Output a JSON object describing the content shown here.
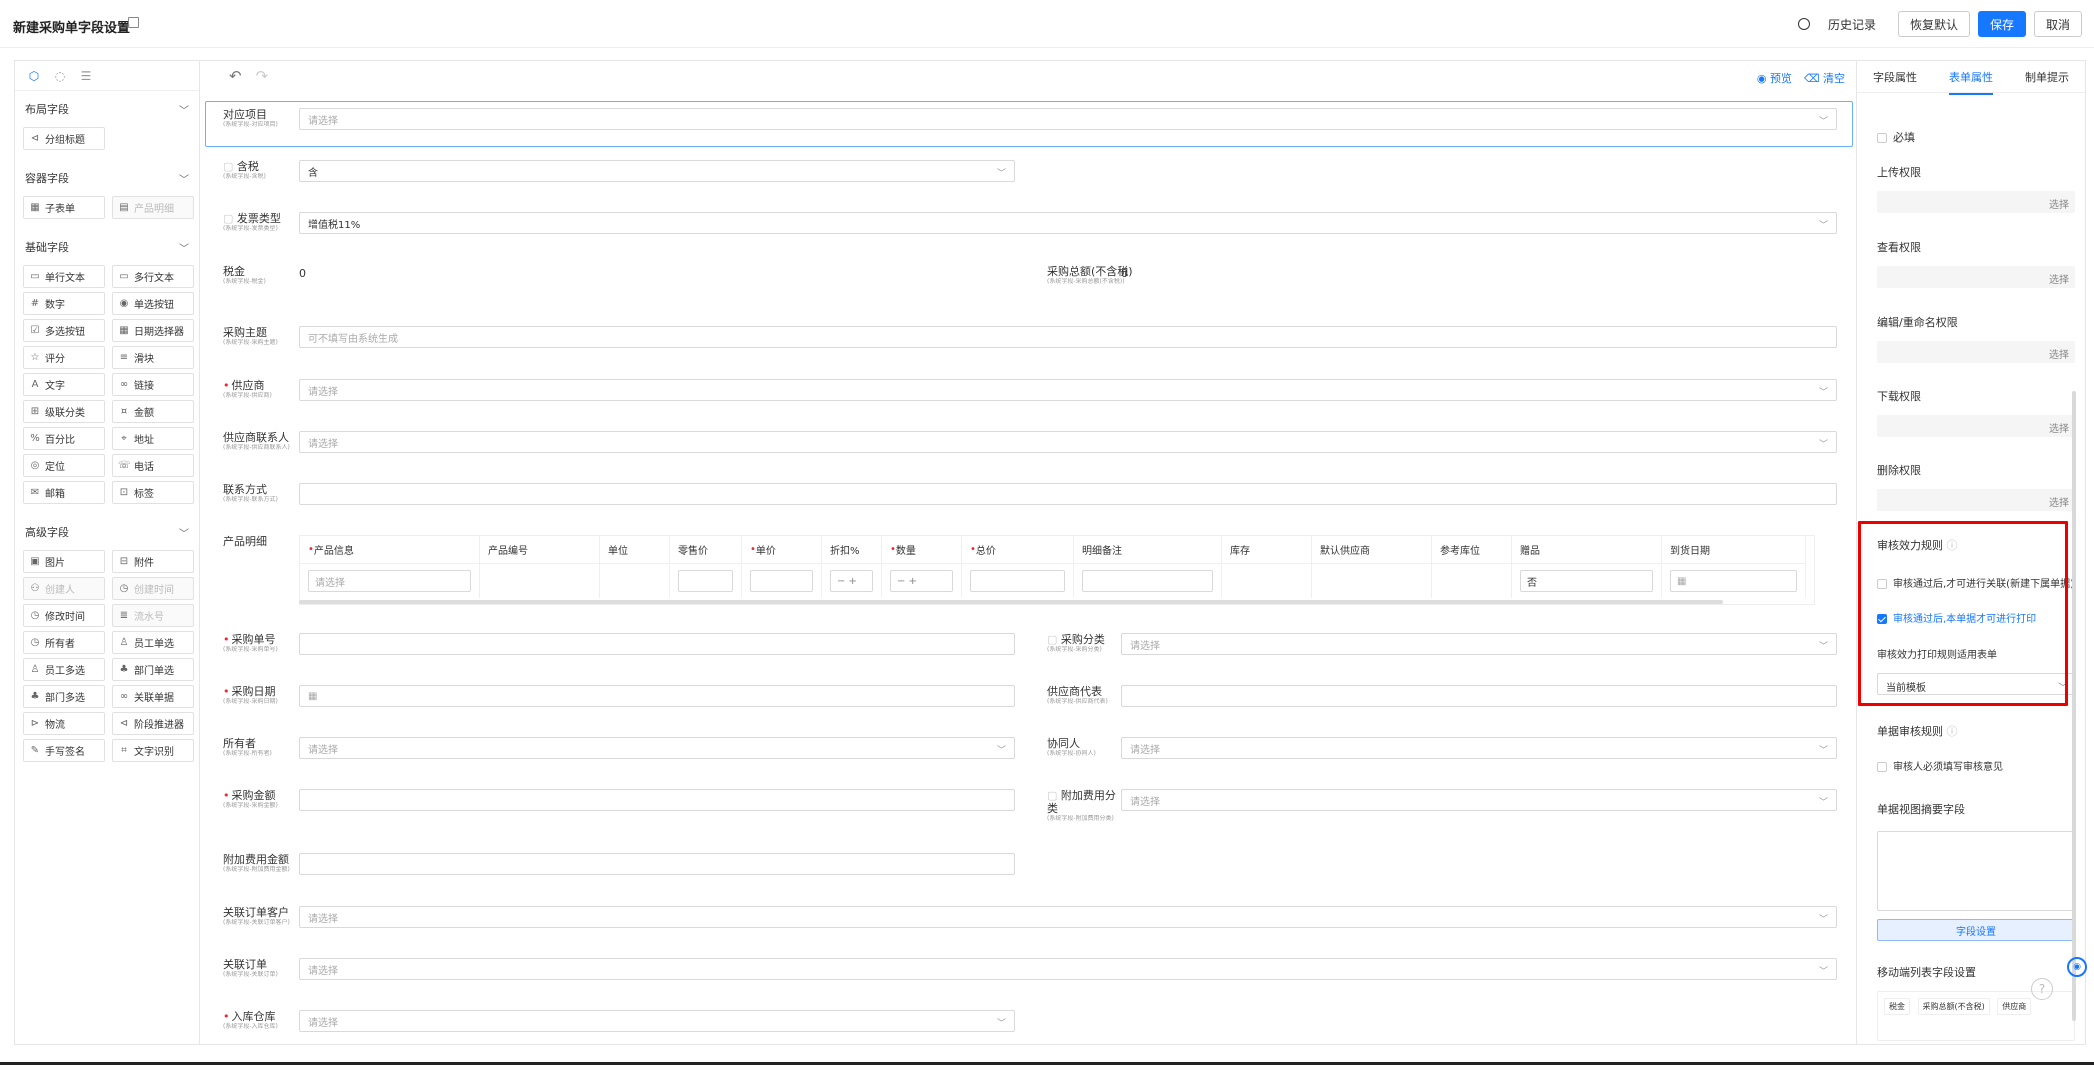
{
  "header": {
    "title": "新建采购单字段设置",
    "history": "历史记录",
    "restore_default": "恢复默认",
    "save": "保存",
    "cancel": "取消"
  },
  "sidebar": {
    "groups": [
      {
        "title": "布局字段",
        "items": [
          {
            "label": "分组标题",
            "icon": "group-title-icon",
            "disabled": false
          }
        ]
      },
      {
        "title": "容器字段",
        "items": [
          {
            "label": "子表单",
            "icon": "subform-icon",
            "disabled": false
          },
          {
            "label": "产品明细",
            "icon": "product-detail-icon",
            "disabled": true
          }
        ]
      },
      {
        "title": "基础字段",
        "items": [
          {
            "label": "单行文本",
            "icon": "single-line-icon",
            "disabled": false
          },
          {
            "label": "多行文本",
            "icon": "multi-line-icon",
            "disabled": false
          },
          {
            "label": "数字",
            "icon": "number-icon",
            "disabled": false
          },
          {
            "label": "单选按钮",
            "icon": "radio-icon",
            "disabled": false
          },
          {
            "label": "多选按钮",
            "icon": "checkbox-icon",
            "disabled": false
          },
          {
            "label": "日期选择器",
            "icon": "date-icon",
            "disabled": false
          },
          {
            "label": "评分",
            "icon": "star-icon",
            "disabled": false
          },
          {
            "label": "滑块",
            "icon": "slider-icon",
            "disabled": false
          },
          {
            "label": "文字",
            "icon": "text-icon",
            "disabled": false
          },
          {
            "label": "链接",
            "icon": "link-icon",
            "disabled": false
          },
          {
            "label": "级联分类",
            "icon": "cascade-icon",
            "disabled": false
          },
          {
            "label": "金额",
            "icon": "money-icon",
            "disabled": false
          },
          {
            "label": "百分比",
            "icon": "percent-icon",
            "disabled": false
          },
          {
            "label": "地址",
            "icon": "location-icon",
            "disabled": false
          },
          {
            "label": "定位",
            "icon": "position-icon",
            "disabled": false
          },
          {
            "label": "电话",
            "icon": "phone-icon",
            "disabled": false
          },
          {
            "label": "邮箱",
            "icon": "mail-icon",
            "disabled": false
          },
          {
            "label": "标签",
            "icon": "tag-icon",
            "disabled": false
          }
        ]
      },
      {
        "title": "高级字段",
        "items": [
          {
            "label": "图片",
            "icon": "image-icon",
            "disabled": false
          },
          {
            "label": "附件",
            "icon": "attachment-icon",
            "disabled": false
          },
          {
            "label": "创建人",
            "icon": "creator-icon",
            "disabled": true
          },
          {
            "label": "创建时间",
            "icon": "created-time-icon",
            "disabled": true
          },
          {
            "label": "修改时间",
            "icon": "modified-time-icon",
            "disabled": false
          },
          {
            "label": "流水号",
            "icon": "serial-icon",
            "disabled": true
          },
          {
            "label": "所有者",
            "icon": "owner-icon",
            "disabled": false
          },
          {
            "label": "员工单选",
            "icon": "employee-icon",
            "disabled": false
          },
          {
            "label": "员工多选",
            "icon": "employees-icon",
            "disabled": false
          },
          {
            "label": "部门单选",
            "icon": "department-icon",
            "disabled": false
          },
          {
            "label": "部门多选",
            "icon": "departments-icon",
            "disabled": false
          },
          {
            "label": "关联单据",
            "icon": "relation-icon",
            "disabled": false
          },
          {
            "label": "物流",
            "icon": "logistics-icon",
            "disabled": false
          },
          {
            "label": "阶段推进器",
            "icon": "stage-icon",
            "disabled": false
          },
          {
            "label": "手写签名",
            "icon": "signature-icon",
            "disabled": false
          },
          {
            "label": "文字识别",
            "icon": "ocr-icon",
            "disabled": false
          }
        ]
      }
    ]
  },
  "canvas": {
    "preview": "预览",
    "clear": "清空",
    "fields": {
      "project": {
        "label": "对应项目",
        "sub": "(系统字段-对应项目)",
        "placeholder": "请选择"
      },
      "tax_incl": {
        "label": "含税",
        "sub": "(系统字段-含税)",
        "value": "含"
      },
      "invoice": {
        "label": "发票类型",
        "sub": "(系统字段-发票类型)",
        "value": "增值税11%"
      },
      "tax": {
        "label": "税金",
        "sub": "(系统字段-税金)",
        "value": "0"
      },
      "total_excl": {
        "label": "采购总额(不含税)",
        "sub": "(系统字段-采购总额(不含税))",
        "value": "0"
      },
      "subject": {
        "label": "采购主题",
        "sub": "(系统字段-采购主题)",
        "placeholder": "可不填写由系统生成"
      },
      "supplier": {
        "label": "供应商",
        "sub": "(系统字段-供应商)",
        "placeholder": "请选择"
      },
      "supplier_contact": {
        "label": "供应商联系人",
        "sub": "(系统字段-供应商联系人)",
        "placeholder": "请选择"
      },
      "contact": {
        "label": "联系方式",
        "sub": "(系统字段-联系方式)"
      },
      "product_detail": {
        "label": "产品明细"
      },
      "order_no": {
        "label": "采购单号",
        "sub": "(系统字段-采购单号)"
      },
      "category": {
        "label": "采购分类",
        "sub": "(系统字段-采购分类)",
        "placeholder": "请选择"
      },
      "date": {
        "label": "采购日期",
        "sub": "(系统字段-采购日期)"
      },
      "supplier_code": {
        "label": "供应商代表",
        "sub": "(系统字段-供应商代表)"
      },
      "owner": {
        "label": "所有者",
        "sub": "(系统字段-所有者)",
        "placeholder": "请选择"
      },
      "collab": {
        "label": "协同人",
        "sub": "(系统字段-协同人)",
        "placeholder": "请选择"
      },
      "amount": {
        "label": "采购金额",
        "sub": "(系统字段-采购金额)"
      },
      "extra_cat": {
        "label": "附加费用分类",
        "sub": "(系统字段-附加费用分类)",
        "placeholder": "请选择"
      },
      "extra_amount": {
        "label": "附加费用金额",
        "sub": "(系统字段-附加费用金额)"
      },
      "rel_customer": {
        "label": "关联订单客户",
        "sub": "(系统字段-关联订单客户)",
        "placeholder": "请选择"
      },
      "rel_order": {
        "label": "关联订单",
        "sub": "(系统字段-关联订单)",
        "placeholder": "请选择"
      },
      "warehouse": {
        "label": "入库仓库",
        "sub": "(系统字段-入库仓库)",
        "placeholder": "请选择"
      }
    },
    "product_table": {
      "headers": [
        "产品信息",
        "产品编号",
        "单位",
        "零售价",
        "单价",
        "折扣%",
        "数量",
        "总价",
        "明细备注",
        "库存",
        "默认供应商",
        "参考库位",
        "赠品",
        "到货日期"
      ],
      "required": [
        true,
        false,
        false,
        false,
        true,
        false,
        true,
        true,
        false,
        false,
        false,
        false,
        false,
        false
      ],
      "row_placeholder": "请选择",
      "gift_value": "否"
    }
  },
  "right_panel": {
    "tabs": [
      "字段属性",
      "表单属性",
      "制单提示"
    ],
    "required": "必填",
    "upload_perm": "上传权限",
    "view_perm": "查看权限",
    "edit_perm": "编辑/重命名权限",
    "download_perm": "下载权限",
    "delete_perm": "删除权限",
    "pick": "选择",
    "audit_rule": "审核效力规则",
    "audit_opt1": "审核通过后,才可进行关联(新建下属单据)",
    "audit_opt2": "审核通过后,本单据才可进行打印",
    "print_rule": "审核效力打印规则适用表单",
    "print_value": "当前模板",
    "doc_audit": "单据审核规则",
    "doc_audit_opt": "审核人必须填写审核意见",
    "summary": "单据视图摘要字段",
    "field_setting": "字段设置",
    "mobile_list": "移动端列表字段设置",
    "mobile_tags": [
      "税金",
      "采购总额(不含税)",
      "供应商"
    ],
    "accent": "#1677ff",
    "highlight": "#e00000"
  }
}
